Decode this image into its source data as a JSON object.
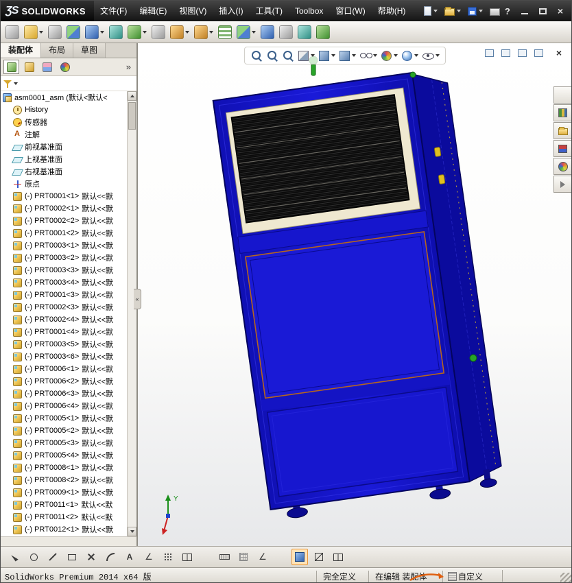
{
  "titlebar": {
    "logo_mark": "ƷS",
    "logo_text": "SOLIDWORKS",
    "menus": [
      "文件(F)",
      "编辑(E)",
      "视图(V)",
      "插入(I)",
      "工具(T)",
      "Toolbox",
      "窗口(W)",
      "帮助(H)"
    ],
    "help_label": "?"
  },
  "toolbar": {
    "items": [
      {
        "name": "insert-component",
        "glyph": "blob-gray",
        "caret": "hide"
      },
      {
        "name": "open-part",
        "glyph": "blob-yellow",
        "caret": "show"
      },
      {
        "name": "attachments",
        "glyph": "blob-gray",
        "caret": "hide"
      },
      {
        "name": "mate",
        "glyph": "blob-multi",
        "caret": "hide"
      },
      {
        "name": "linear-component-pattern",
        "glyph": "blob-blue",
        "caret": "show"
      },
      {
        "name": "smart-fasteners",
        "glyph": "blob-teal",
        "caret": "hide"
      },
      {
        "name": "move-component",
        "glyph": "blob-green",
        "caret": "show"
      },
      {
        "name": "show-hidden-components",
        "glyph": "blob-gray",
        "caret": "hide"
      },
      {
        "name": "assembly-features",
        "glyph": "blob-gold",
        "caret": "show"
      },
      {
        "name": "reference-geometry",
        "glyph": "blob-gold",
        "caret": "show"
      },
      {
        "name": "bill-of-materials",
        "glyph": "blob-table",
        "caret": "hide"
      },
      {
        "name": "exploded-view",
        "glyph": "blob-multi",
        "caret": "show"
      },
      {
        "name": "explode-line-sketch",
        "glyph": "blob-blue",
        "caret": "hide"
      },
      {
        "name": "interference-detection",
        "glyph": "blob-gray",
        "caret": "hide"
      },
      {
        "name": "instant-3d",
        "glyph": "blob-teal",
        "caret": "hide"
      },
      {
        "name": "update-assembly",
        "glyph": "blob-green",
        "caret": "hide"
      }
    ]
  },
  "left_panel": {
    "tabs": [
      {
        "label": "装配体",
        "state": "active"
      },
      {
        "label": "布局",
        "state": ""
      },
      {
        "label": "草图",
        "state": ""
      }
    ],
    "head_buttons": [
      {
        "name": "featuremanager-tab",
        "glyph": "ph-tree",
        "state": "pressed"
      },
      {
        "name": "propertymanager-tab",
        "glyph": "ph-props",
        "state": ""
      },
      {
        "name": "configurationmanager-tab",
        "glyph": "ph-config",
        "state": ""
      },
      {
        "name": "displaymanager-tab",
        "glyph": "ph-sphere",
        "state": ""
      }
    ],
    "expand_label": "»",
    "splitter_label": "«",
    "tree_items": [
      {
        "icon": "assembly-root-icon",
        "indent": "lvl0",
        "label": "asm0001_asm (默认<默认<",
        "suffix": ""
      },
      {
        "icon": "history-icon",
        "indent": "lvl1",
        "label": "History",
        "suffix": ""
      },
      {
        "icon": "sensors-icon",
        "indent": "lvl1",
        "label": "传感器",
        "suffix": ""
      },
      {
        "icon": "annotations-icon",
        "indent": "lvl1",
        "label": "注解",
        "suffix": ""
      },
      {
        "icon": "plane-icon",
        "indent": "lvl1",
        "label": "前视基准面",
        "suffix": ""
      },
      {
        "icon": "plane-icon",
        "indent": "lvl1",
        "label": "上视基准面",
        "suffix": ""
      },
      {
        "icon": "plane-icon",
        "indent": "lvl1",
        "label": "右视基准面",
        "suffix": ""
      },
      {
        "icon": "origin-icon",
        "indent": "lvl1",
        "label": "原点",
        "suffix": ""
      },
      {
        "icon": "part-icon",
        "indent": "lvl1",
        "label": "(-) PRT0001<1>",
        "suffix": "默认<<默"
      },
      {
        "icon": "part-icon",
        "indent": "lvl1",
        "label": "(-) PRT0002<1>",
        "suffix": "默认<<默"
      },
      {
        "icon": "part-icon",
        "indent": "lvl1",
        "label": "(-) PRT0002<2>",
        "suffix": "默认<<默"
      },
      {
        "icon": "part-icon",
        "indent": "lvl1",
        "label": "(-) PRT0001<2>",
        "suffix": "默认<<默"
      },
      {
        "icon": "part-icon",
        "indent": "lvl1",
        "label": "(-) PRT0003<1>",
        "suffix": "默认<<默"
      },
      {
        "icon": "part-icon",
        "indent": "lvl1",
        "label": "(-) PRT0003<2>",
        "suffix": "默认<<默"
      },
      {
        "icon": "part-icon",
        "indent": "lvl1",
        "label": "(-) PRT0003<3>",
        "suffix": "默认<<默"
      },
      {
        "icon": "part-icon",
        "indent": "lvl1",
        "label": "(-) PRT0003<4>",
        "suffix": "默认<<默"
      },
      {
        "icon": "part-icon",
        "indent": "lvl1",
        "label": "(-) PRT0001<3>",
        "suffix": "默认<<默"
      },
      {
        "icon": "part-icon",
        "indent": "lvl1",
        "label": "(-) PRT0002<3>",
        "suffix": "默认<<默"
      },
      {
        "icon": "part-icon",
        "indent": "lvl1",
        "label": "(-) PRT0002<4>",
        "suffix": "默认<<默"
      },
      {
        "icon": "part-icon",
        "indent": "lvl1",
        "label": "(-) PRT0001<4>",
        "suffix": "默认<<默"
      },
      {
        "icon": "part-icon",
        "indent": "lvl1",
        "label": "(-) PRT0003<5>",
        "suffix": "默认<<默"
      },
      {
        "icon": "part-icon",
        "indent": "lvl1",
        "label": "(-) PRT0003<6>",
        "suffix": "默认<<默"
      },
      {
        "icon": "part-icon",
        "indent": "lvl1",
        "label": "(-) PRT0006<1>",
        "suffix": "默认<<默"
      },
      {
        "icon": "part-icon",
        "indent": "lvl1",
        "label": "(-) PRT0006<2>",
        "suffix": "默认<<默"
      },
      {
        "icon": "part-icon",
        "indent": "lvl1",
        "label": "(-) PRT0006<3>",
        "suffix": "默认<<默"
      },
      {
        "icon": "part-icon",
        "indent": "lvl1",
        "label": "(-) PRT0006<4>",
        "suffix": "默认<<默"
      },
      {
        "icon": "part-icon",
        "indent": "lvl1",
        "label": "(-) PRT0005<1>",
        "suffix": "默认<<默"
      },
      {
        "icon": "part-icon",
        "indent": "lvl1",
        "label": "(-) PRT0005<2>",
        "suffix": "默认<<默"
      },
      {
        "icon": "part-icon",
        "indent": "lvl1",
        "label": "(-) PRT0005<3>",
        "suffix": "默认<<默"
      },
      {
        "icon": "part-icon",
        "indent": "lvl1",
        "label": "(-) PRT0005<4>",
        "suffix": "默认<<默"
      },
      {
        "icon": "part-icon",
        "indent": "lvl1",
        "label": "(-) PRT0008<1>",
        "suffix": "默认<<默"
      },
      {
        "icon": "part-icon",
        "indent": "lvl1",
        "label": "(-) PRT0008<2>",
        "suffix": "默认<<默"
      },
      {
        "icon": "part-icon",
        "indent": "lvl1",
        "label": "(-) PRT0009<1>",
        "suffix": "默认<<默"
      },
      {
        "icon": "part-icon",
        "indent": "lvl1",
        "label": "(-) PRT0011<1>",
        "suffix": "默认<<默"
      },
      {
        "icon": "part-icon",
        "indent": "lvl1",
        "label": "(-) PRT0011<2>",
        "suffix": "默认<<默"
      },
      {
        "icon": "part-icon",
        "indent": "lvl1",
        "label": "(-) PRT0012<1>",
        "suffix": "默认<<默"
      }
    ]
  },
  "viewport": {
    "headsup_items": [
      {
        "name": "zoom-to-fit",
        "glyph": "g-magnifier",
        "caret": "hide"
      },
      {
        "name": "zoom-to-area",
        "glyph": "g-magnifier",
        "caret": "hide"
      },
      {
        "name": "previous-view",
        "glyph": "g-magnifier",
        "caret": "hide"
      },
      {
        "name": "section-view",
        "glyph": "g-section",
        "caret": "show"
      },
      {
        "name": "view-orientation",
        "glyph": "g-cube",
        "caret": "show"
      },
      {
        "name": "display-style",
        "glyph": "g-cube",
        "caret": "show"
      },
      {
        "name": "hide-show-items",
        "glyph": "g-glasses",
        "caret": "show"
      },
      {
        "name": "edit-appearance",
        "glyph": "g-sphere-multi",
        "caret": "show"
      },
      {
        "name": "apply-scene",
        "glyph": "g-sphere",
        "caret": "show"
      },
      {
        "name": "view-settings",
        "glyph": "g-eye",
        "caret": "show"
      }
    ],
    "taskpane_items": [
      {
        "name": "solidworks-resources",
        "glyph": "rp-home"
      },
      {
        "name": "design-library",
        "glyph": "rp-books"
      },
      {
        "name": "file-explorer",
        "glyph": "rp-folder"
      },
      {
        "name": "view-palette",
        "glyph": "rp-palette"
      },
      {
        "name": "appearances-scenes",
        "glyph": "rp-sphere"
      },
      {
        "name": "custom-properties",
        "glyph": "rp-arrow"
      }
    ],
    "triad_label": "Y",
    "model_colors": {
      "body_blue": "#1515cf",
      "edge_dark": "#04045e",
      "mesh_black": "#0a0a0a",
      "filter_frame_cream": "#efe8d0",
      "door_outline_orange": "#b5651d",
      "accent_green": "#28a428",
      "accent_yellow": "#e0c020"
    }
  },
  "sketch_toolbar": {
    "items": [
      {
        "name": "select-tool",
        "glyph": "sg-arrow",
        "state": ""
      },
      {
        "name": "circle-tool",
        "glyph": "sg-circle",
        "state": ""
      },
      {
        "name": "line-tool",
        "glyph": "sg-line",
        "state": ""
      },
      {
        "name": "rectangle-tool",
        "glyph": "sg-rect",
        "state": ""
      },
      {
        "name": "trim-entities",
        "glyph": "sg-cross",
        "state": ""
      },
      {
        "name": "arc-tool",
        "glyph": "sg-arc",
        "state": ""
      },
      {
        "name": "text-tool",
        "glyph": "sg-letter",
        "state": ""
      },
      {
        "name": "smart-dimension",
        "glyph": "sg-angle",
        "state": ""
      },
      {
        "name": "point-pattern",
        "glyph": "sg-dots",
        "state": ""
      },
      {
        "name": "mirror-entities",
        "glyph": "sg-panes",
        "state": ""
      },
      {
        "name": "ruler-tool",
        "glyph": "sg-ruler",
        "state": "gap"
      },
      {
        "name": "grid-snap",
        "glyph": "sg-grid",
        "state": ""
      },
      {
        "name": "angle-snap",
        "glyph": "sg-angle",
        "state": ""
      },
      {
        "name": "shaded-with-edges",
        "glyph": "sg-cube",
        "state": "gap active"
      },
      {
        "name": "section-display",
        "glyph": "sg-section",
        "state": ""
      },
      {
        "name": "viewport-panes",
        "glyph": "sg-panes",
        "state": ""
      }
    ]
  },
  "statusbar": {
    "app_info": "SolidWorks Premium 2014 x64 版",
    "define_state": "完全定义",
    "edit_state": "在编辑 装配体",
    "custom": "自定义"
  }
}
